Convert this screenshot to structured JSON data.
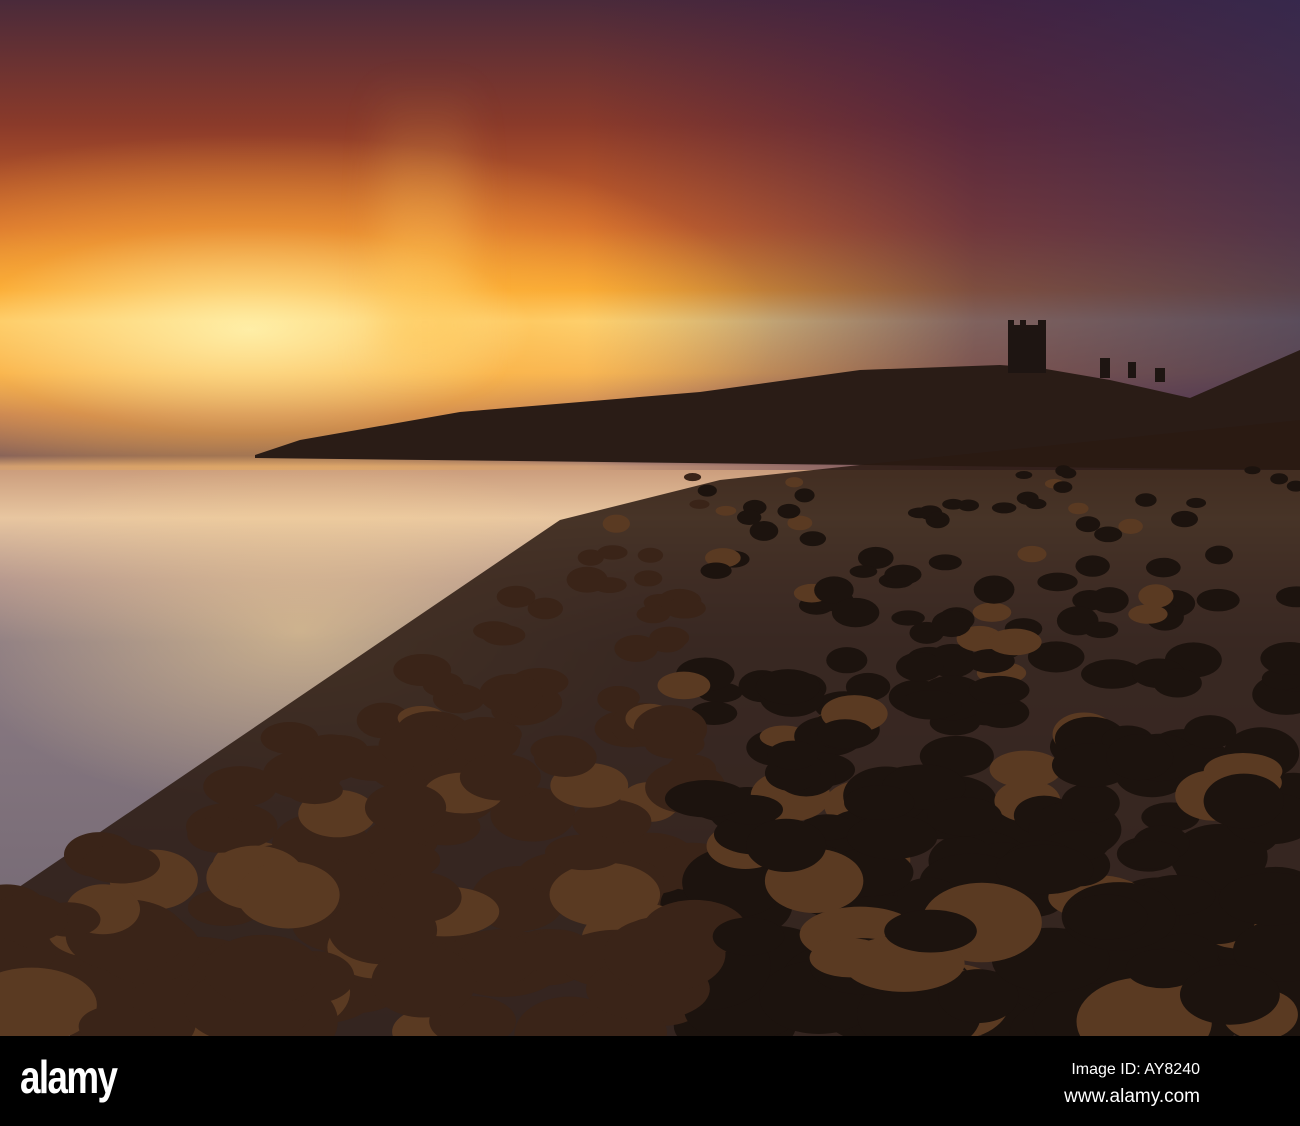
{
  "footer": {
    "logo": "alamy",
    "image_id": "Image ID: AY8240",
    "url": "www.alamy.com"
  },
  "watermark": "alamy",
  "colors": {
    "sun": "#fde08a",
    "sky_dark": "#4a2a3a",
    "stone": "#1a120e",
    "footer": "#000000"
  }
}
